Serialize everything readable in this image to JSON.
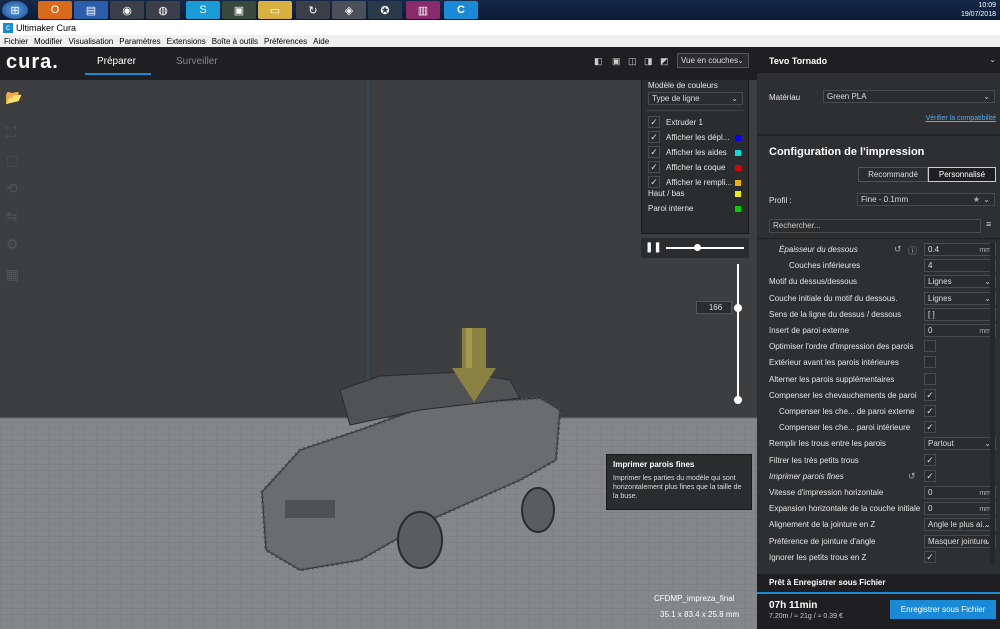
{
  "taskbar": {
    "time": "10:09",
    "date": "19/07/2018"
  },
  "window": {
    "title": "Ultimaker Cura"
  },
  "menu": [
    "Fichier",
    "Modifier",
    "Visualisation",
    "Paramètres",
    "Extensions",
    "Boîte à outils",
    "Préférences",
    "Aide"
  ],
  "header": {
    "logo": "cura.",
    "tab_prepare": "Préparer",
    "tab_monitor": "Surveiller",
    "view_select": "Vue en couches"
  },
  "color_panel": {
    "title": "Modèle de couleurs",
    "scheme": "Type de ligne",
    "items": [
      {
        "label": "Extruder 1",
        "checked": true,
        "color": ""
      },
      {
        "label": "Afficher les dépl...",
        "checked": true,
        "color": "#0000ff"
      },
      {
        "label": "Afficher les aides",
        "checked": true,
        "color": "#00e0e0"
      },
      {
        "label": "Afficher la coque",
        "checked": true,
        "color": "#e00000"
      },
      {
        "label": "Afficher le rempli...",
        "checked": true,
        "color": "#f0b000"
      }
    ],
    "legend": [
      {
        "label": "Haut / bas",
        "color": "#f0f000"
      },
      {
        "label": "Paroi interne",
        "color": "#00d000"
      }
    ]
  },
  "layer_value": "166",
  "model": {
    "name": "CFDMP_impreza_final",
    "dims": "35.1 x 83.4 x 25.8 mm"
  },
  "tooltip": {
    "title": "Imprimer parois fines",
    "body": "Imprimer les parties du modèle qui sont horizontalement plus fines que la taille de la buse."
  },
  "printer": {
    "name": "Tevo Tornado",
    "material_label": "Matériau",
    "material": "Green PLA",
    "compat_link": "Vérifier la compatibilité"
  },
  "config": {
    "title": "Configuration de l'impression",
    "tab_recommended": "Recommandé",
    "tab_custom": "Personnalisé",
    "profile_label": "Profil :",
    "profile": "Fine - 0.1mm",
    "search_placeholder": "Rechercher..."
  },
  "settings": [
    {
      "label": "Épaisseur du dessous",
      "value": "0.4",
      "unit": "mm",
      "type": "num",
      "italic": true,
      "indent": 1
    },
    {
      "label": "Couches inférieures",
      "value": "4",
      "unit": "",
      "type": "num",
      "italic": false,
      "indent": 2
    },
    {
      "label": "Motif du dessus/dessous",
      "value": "Lignes",
      "unit": "",
      "type": "sel",
      "italic": false,
      "indent": 0
    },
    {
      "label": "Couche initiale du motif du dessous.",
      "value": "Lignes",
      "unit": "",
      "type": "sel",
      "italic": false,
      "indent": 0
    },
    {
      "label": "Sens de la ligne du dessus / dessous",
      "value": "[ ]",
      "unit": "",
      "type": "num",
      "italic": false,
      "indent": 0
    },
    {
      "label": "Insert de paroi externe",
      "value": "0",
      "unit": "mm",
      "type": "num",
      "italic": false,
      "indent": 0
    },
    {
      "label": "Optimiser l'ordre d'impression des parois",
      "value": "",
      "unit": "",
      "type": "chk",
      "checked": false,
      "italic": false,
      "indent": 0
    },
    {
      "label": "Extérieur avant les parois intérieures",
      "value": "",
      "unit": "",
      "type": "chk",
      "checked": false,
      "italic": false,
      "indent": 0
    },
    {
      "label": "Alterner les parois supplémentaires",
      "value": "",
      "unit": "",
      "type": "chk",
      "checked": false,
      "italic": false,
      "indent": 0
    },
    {
      "label": "Compenser les chevauchements de paroi",
      "value": "",
      "unit": "",
      "type": "chk",
      "checked": true,
      "italic": false,
      "indent": 0
    },
    {
      "label": "Compenser les che... de paroi externe",
      "value": "",
      "unit": "",
      "type": "chk",
      "checked": true,
      "italic": false,
      "indent": 1
    },
    {
      "label": "Compenser les che... paroi intérieure",
      "value": "",
      "unit": "",
      "type": "chk",
      "checked": true,
      "italic": false,
      "indent": 1
    },
    {
      "label": "Remplir les trous entre les parois",
      "value": "Partout",
      "unit": "",
      "type": "sel",
      "italic": false,
      "indent": 0
    },
    {
      "label": "Filtrer les très petits trous",
      "value": "",
      "unit": "",
      "type": "chk",
      "checked": true,
      "italic": false,
      "indent": 0
    },
    {
      "label": "Imprimer parois fines",
      "value": "",
      "unit": "",
      "type": "chk",
      "checked": true,
      "italic": true,
      "indent": 0
    },
    {
      "label": "Vitesse d'impression horizontale",
      "value": "0",
      "unit": "mm",
      "type": "num",
      "italic": false,
      "indent": 0
    },
    {
      "label": "Expansion horizontale de la couche initiale",
      "value": "0",
      "unit": "mm",
      "type": "num",
      "italic": false,
      "indent": 0
    },
    {
      "label": "Alignement de la jointure en Z",
      "value": "Angle le plus ai...",
      "unit": "",
      "type": "sel",
      "italic": false,
      "indent": 0
    },
    {
      "label": "Préférence de jointure d'angle",
      "value": "Masquer jointure",
      "unit": "",
      "type": "sel",
      "italic": false,
      "indent": 0
    },
    {
      "label": "Ignorer les petits trous en Z",
      "value": "",
      "unit": "",
      "type": "chk",
      "checked": true,
      "italic": false,
      "indent": 0
    }
  ],
  "footer": {
    "ready": "Prêt à Enregistrer sous Fichier",
    "time": "07h 11min",
    "stats": "7.20m / ≈ 21g / ≈ 0.39 €",
    "save": "Enregistrer sous Fichier"
  }
}
